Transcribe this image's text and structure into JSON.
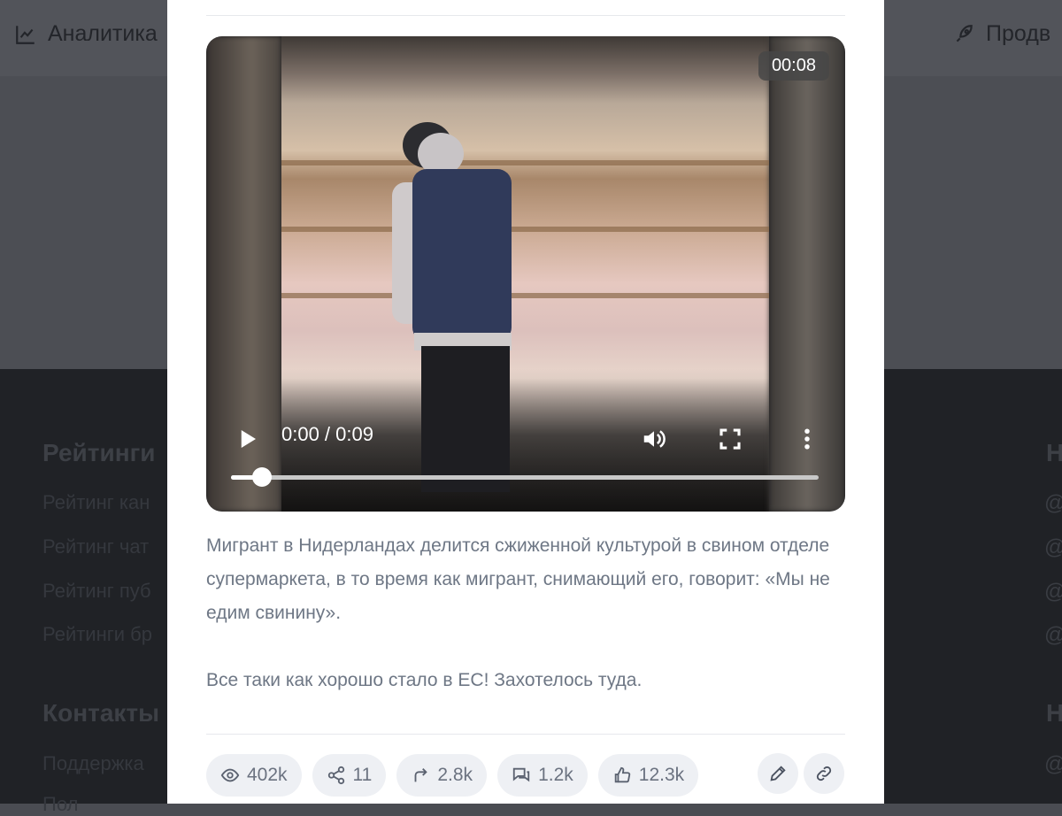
{
  "background": {
    "nav": {
      "analytics_label": "Аналитика",
      "promo_label": "Продв"
    },
    "footer": {
      "ratings_heading": "Рейтинги",
      "ratings_links": [
        "Рейтинг кан",
        "Рейтинг чат",
        "Рейтинг пуб",
        "Рейтинги бр"
      ],
      "contacts_heading": "Контакты",
      "contacts_links": [
        "Поддержка",
        "Пол"
      ],
      "right_heading": "Н",
      "right_icons": [
        "@",
        "@",
        "@",
        "@"
      ],
      "right_heading_2": "Н",
      "right_icons_2": [
        "@"
      ]
    }
  },
  "video": {
    "duration_badge": "00:08",
    "time_display": "0:00 / 0:09",
    "progress_fraction": 0.053,
    "icons": {
      "play": "play-icon",
      "volume": "volume-icon",
      "fullscreen": "fullscreen-icon",
      "more": "more-vertical-icon"
    }
  },
  "post": {
    "paragraph1": "Мигрант в Нидерландах делится сжиженной культурой в свином отделе супермаркета, в то время как мигрант, снимающий его, говорит: «Мы не едим свинину».",
    "paragraph2": "Все таки как хорошо стало в ЕС! Захотелось туда."
  },
  "stats": {
    "views": "402k",
    "shares": "11",
    "forwards": "2.8k",
    "comments": "1.2k",
    "reactions": "12.3k",
    "icons": [
      "eye-icon",
      "share-nodes-icon",
      "forward-arrow-icon",
      "comments-icon",
      "thumbs-up-icon",
      "pencil-icon",
      "link-icon"
    ]
  },
  "colors": {
    "overlay": "#4a4c52",
    "modal": "#ffffff",
    "pill_bg": "#eef0f4",
    "text_muted": "#6e7785"
  }
}
